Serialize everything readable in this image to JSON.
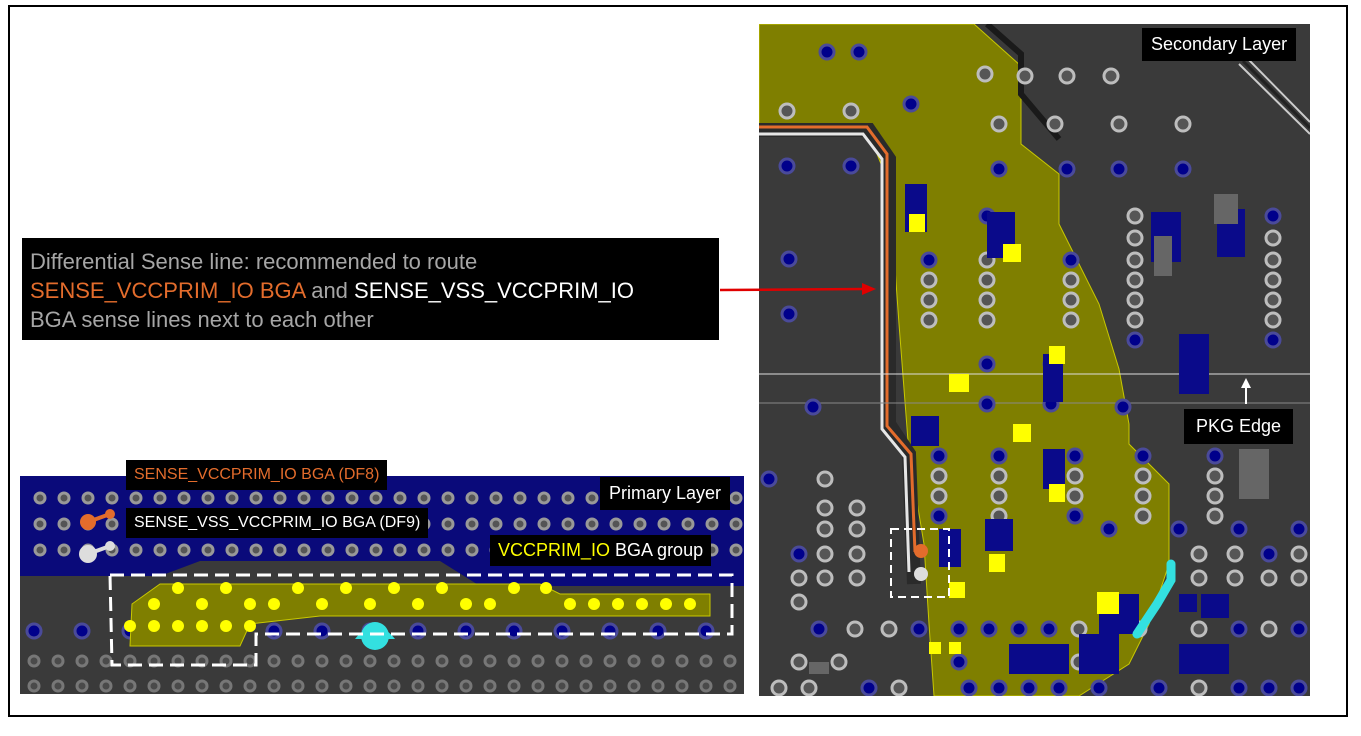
{
  "callout": {
    "line1": "Differential Sense line: recommended to route",
    "line2_orange": "SENSE_VCCPRIM_IO BGA",
    "line2_and": " and ",
    "line2_white": "SENSE_VSS_VCCPRIM_IO",
    "line3": "BGA sense lines next to each other"
  },
  "secondary_panel": {
    "title": "Secondary Layer",
    "pkg_edge_label": "PKG Edge"
  },
  "primary_panel": {
    "title": "Primary Layer",
    "legend_orange": "SENSE_VCCPRIM_IO BGA (DF8)",
    "legend_white": "SENSE_VSS_VCCPRIM_IO BGA (DF9)",
    "group_yellow": "VCCPRIM_IO",
    "group_rest": " BGA group"
  },
  "colors": {
    "board_bg": "#3a3a3a",
    "copper_fill": "#7f7f00",
    "via_blue": "#00008b",
    "sense_orange": "#e36c2c",
    "sense_white": "#ffffff",
    "highlight_yellow": "#ffff00",
    "cyan": "#33e0e0",
    "arrow_red": "#e00000"
  }
}
